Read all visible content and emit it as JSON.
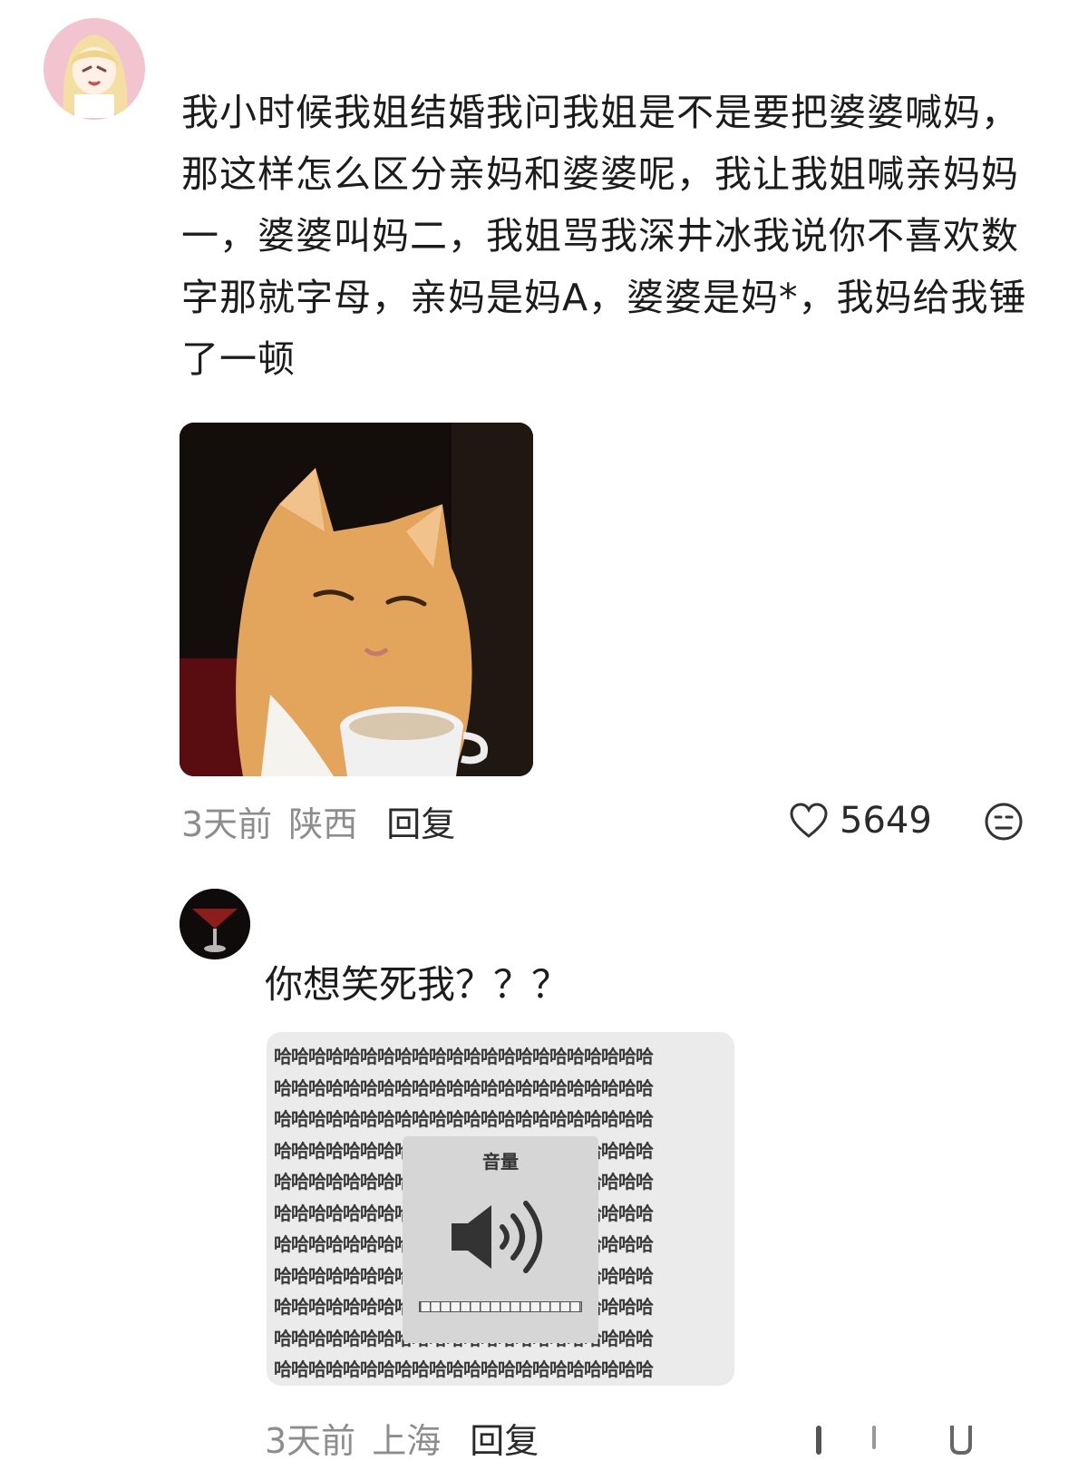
{
  "comment1": {
    "avatar": "anime-girl-avatar",
    "text": "我小时候我姐结婚我问我姐是不是要把婆婆喊妈，那这样怎么区分亲妈和婆婆呢，我让我姐喊亲妈妈一，婆婆叫妈二，我姐骂我深井冰我说你不喜欢数字那就字母，亲妈是妈A，婆婆是妈*，我妈给我锤了一顿",
    "image": "cat-drinking-coffee",
    "time": "3天前",
    "location": "陕西",
    "reply_label": "回复",
    "like_icon": "heart-icon",
    "like_count": "5649",
    "extra_icon": "emoji-face-icon"
  },
  "comment2": {
    "avatar": "cocktail-glass-avatar",
    "text": "你想笑死我？？？",
    "image": "haha-volume-meme",
    "meme_fill_text": "哈哈哈哈哈哈哈哈哈哈哈哈哈哈哈哈哈哈哈哈哈哈",
    "volume_title": "音量",
    "volume_icon": "speaker-volume-icon",
    "time": "3天前",
    "location": "上海",
    "reply_label": "回复"
  },
  "colors": {
    "text_primary": "#1c1c1c",
    "text_secondary": "#8d8d8d",
    "avatar1_bg": "#f2c4cf"
  }
}
